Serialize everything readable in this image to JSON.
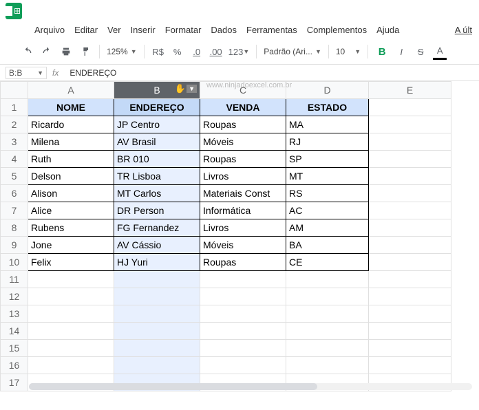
{
  "menus": [
    "Arquivo",
    "Editar",
    "Ver",
    "Inserir",
    "Formatar",
    "Dados",
    "Ferramentas",
    "Complementos",
    "Ajuda"
  ],
  "menu_right": "A últ",
  "toolbar": {
    "zoom": "125%",
    "currency": "R$",
    "percent": "%",
    "dec_dec": ".0",
    "dec_inc": ".00",
    "numfmt": "123",
    "fontname": "Padrão (Ari...",
    "fontsize": "10",
    "bold": "B",
    "italic": "I",
    "strike": "S",
    "underline": "A"
  },
  "namebox": "B:B",
  "formula": "ENDEREÇO",
  "watermark": "www.ninjadoexcel.com.br",
  "col_headers": [
    "A",
    "B",
    "C",
    "D",
    "E"
  ],
  "table": {
    "headers": [
      "NOME",
      "ENDEREÇO",
      "VENDA",
      "ESTADO"
    ],
    "rows": [
      [
        "Ricardo",
        "JP Centro",
        "Roupas",
        "MA"
      ],
      [
        "Milena",
        "AV Brasil",
        "Móveis",
        "RJ"
      ],
      [
        "Ruth",
        "BR 010",
        "Roupas",
        "SP"
      ],
      [
        "Delson",
        "TR Lisboa",
        "Livros",
        "MT"
      ],
      [
        "Alison",
        "MT Carlos",
        "Materiais Const",
        "RS"
      ],
      [
        "Alice",
        "DR Person",
        "Informática",
        "AC"
      ],
      [
        "Rubens",
        "FG Fernandez",
        "Livros",
        "AM"
      ],
      [
        "Jone",
        "AV Cássio",
        "Móveis",
        "BA"
      ],
      [
        "Felix",
        "HJ Yuri",
        "Roupas",
        "CE"
      ]
    ]
  }
}
